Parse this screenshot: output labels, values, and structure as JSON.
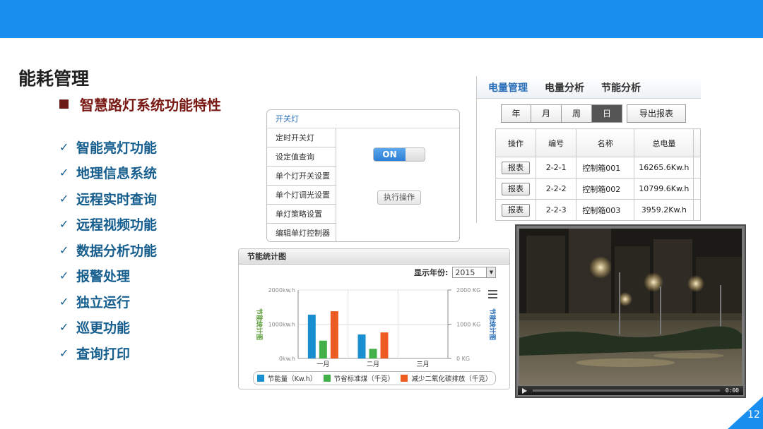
{
  "colors": {
    "topbar": "#1a8ff0",
    "title": "#1f1f1f",
    "subtitle": "#7a1a14",
    "features": "#155e8e"
  },
  "title": "能耗管理",
  "subtitle": "智慧路灯系统功能特性",
  "features": [
    "智能亮灯功能",
    "地理信息系统",
    "远程实时查询",
    "远程视频功能",
    "数据分析功能",
    "报警处理",
    "独立运行",
    "巡更功能",
    "查询打印"
  ],
  "check_icon": "checkmark-icon",
  "switch_panel": {
    "header": "开关灯",
    "menu": [
      "定时开关灯",
      "设定值查询",
      "单个灯开关设置",
      "单个灯调光设置",
      "单灯策略设置",
      "编辑单灯控制器"
    ],
    "toggle_label": "ON",
    "exec_label": "执行操作"
  },
  "power_panel": {
    "tabs": [
      "电量管理",
      "电量分析",
      "节能分析"
    ],
    "range": [
      "年",
      "月",
      "周",
      "日"
    ],
    "selected_range": "日",
    "export_label": "导出报表",
    "columns": [
      "操作",
      "编号",
      "名称",
      "总电量"
    ],
    "report_label": "报表",
    "rows": [
      {
        "id": "2-2-1",
        "name": "控制箱001",
        "total": "16265.6Kw.h"
      },
      {
        "id": "2-2-2",
        "name": "控制箱002",
        "total": "10799.6Kw.h"
      },
      {
        "id": "2-2-3",
        "name": "控制箱003",
        "total": "3959.2Kw.h"
      }
    ]
  },
  "chart_panel": {
    "header": "节能统计图",
    "year_label": "显示年份:",
    "year_value": "2015"
  },
  "chart_data": {
    "type": "bar",
    "categories": [
      "一月",
      "二月",
      "三月"
    ],
    "series": [
      {
        "name": "节能量（Kw.h）",
        "values": [
          1280,
          700,
          0
        ],
        "axis": "left",
        "color": "#1a8fd0"
      },
      {
        "name": "节省标准煤（千克）",
        "values": [
          520,
          280,
          0
        ],
        "axis": "right",
        "color": "#44b04a"
      },
      {
        "name": "减少二氧化碳排放（千克）",
        "values": [
          1380,
          760,
          0
        ],
        "axis": "right",
        "color": "#ee5a24"
      }
    ],
    "ylabel": "节能统计图",
    "y2label": "节能统计图",
    "yticks": [
      "0kw.h",
      "1000kw.h",
      "2000kw.h"
    ],
    "y2ticks": [
      "0 KG",
      "1000 KG",
      "2000 KG"
    ],
    "ylim": [
      0,
      2000
    ],
    "y2lim": [
      0,
      2000
    ],
    "grid": true,
    "legend": "bottom"
  },
  "video": {
    "time": "0:00"
  },
  "page_number": "12"
}
